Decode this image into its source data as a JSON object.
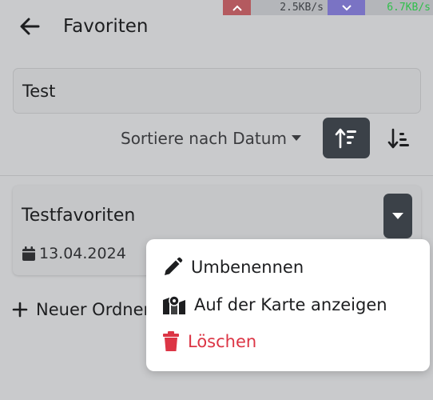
{
  "header": {
    "title": "Favoriten",
    "back_icon": "arrow-left-icon"
  },
  "network_monitor": {
    "upload": "2.5KB/s",
    "download": "6.7KB/s"
  },
  "search": {
    "value": "Test"
  },
  "sort": {
    "label": "Sortiere nach Datum",
    "asc_icon": "sort-ascending-icon",
    "desc_icon": "sort-descending-icon"
  },
  "folder": {
    "title": "Testfavoriten",
    "date": "13.04.2024"
  },
  "new_folder": {
    "label": "Neuer Ordner"
  },
  "context_menu": {
    "items": [
      {
        "label": "Umbenennen",
        "icon": "pencil-icon"
      },
      {
        "label": "Auf der Karte anzeigen",
        "icon": "map-marker-icon"
      },
      {
        "label": "Löschen",
        "icon": "trash-icon",
        "color": "#dc3545"
      }
    ]
  },
  "colors": {
    "accent_dark": "#3b4148",
    "danger": "#dc3545",
    "background_dimmed": "#c9cacc"
  }
}
